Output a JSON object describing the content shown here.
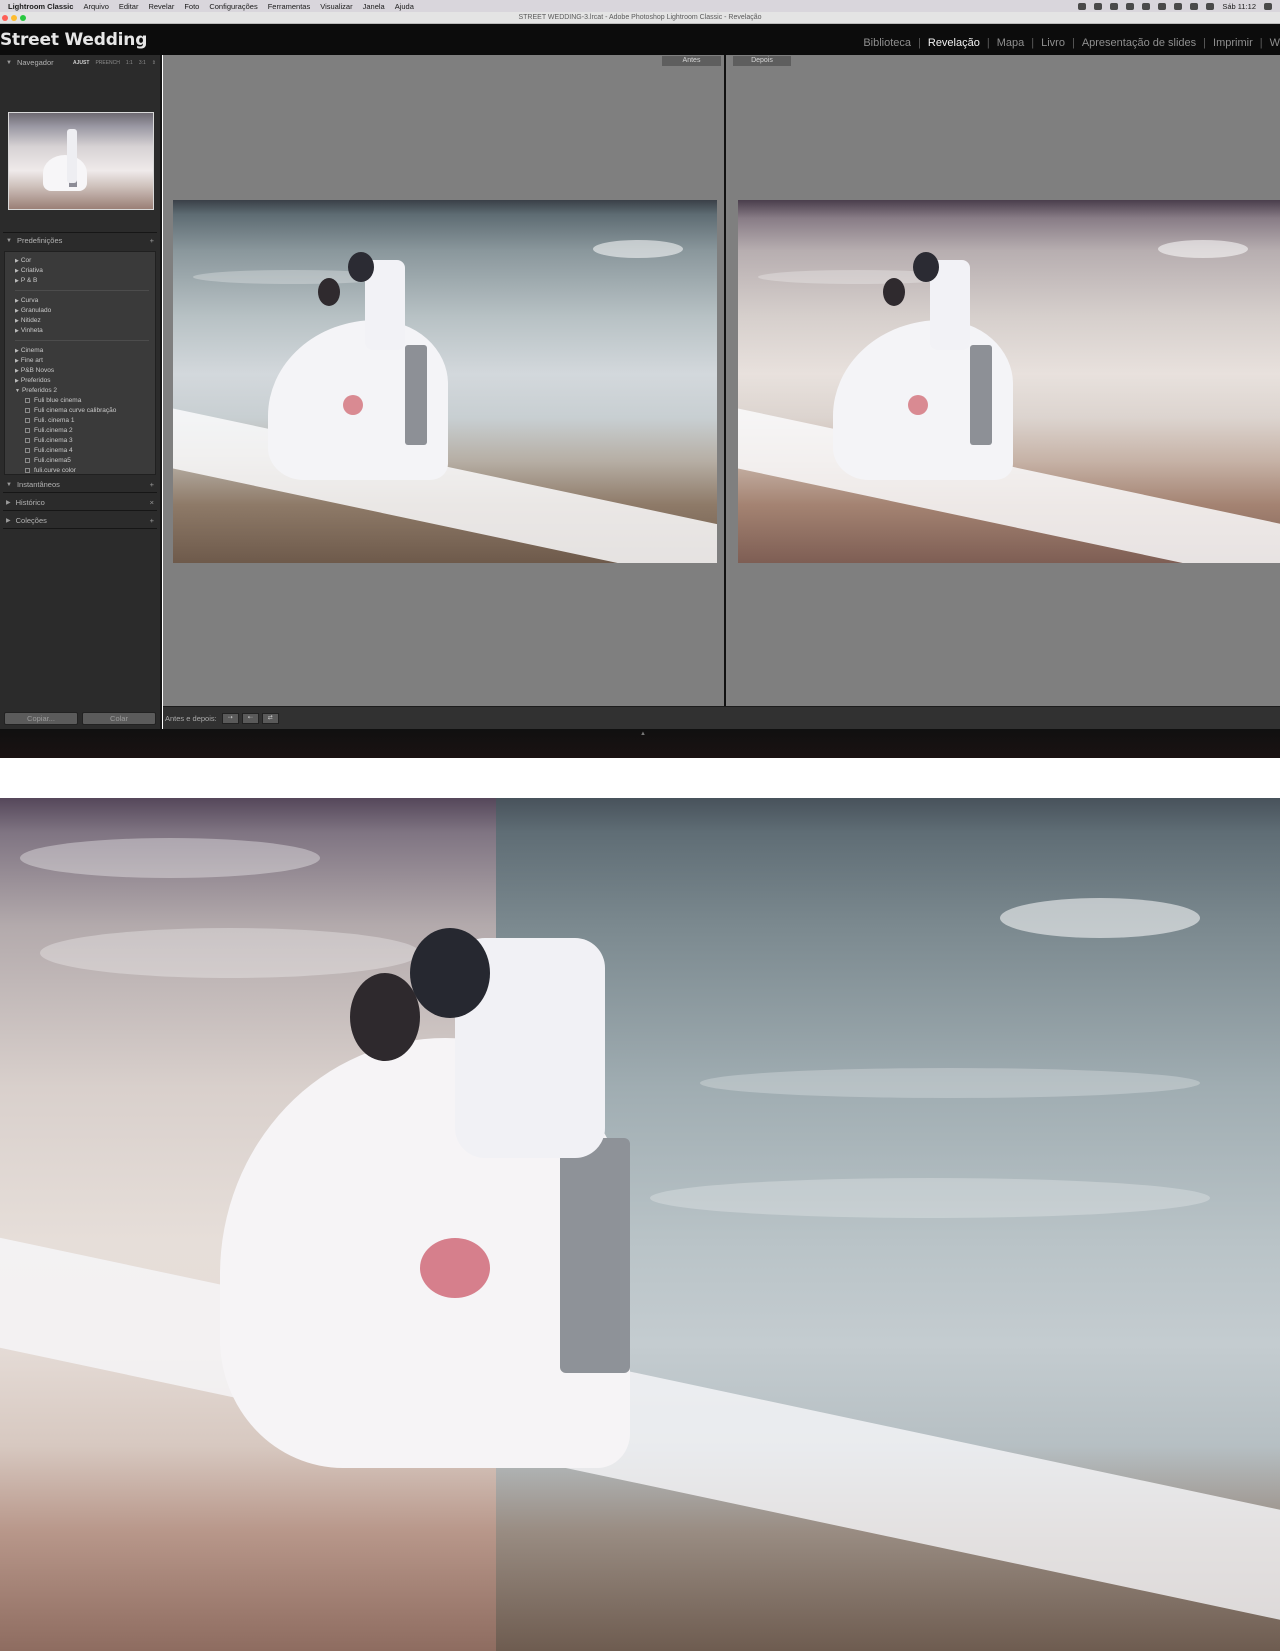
{
  "menubar": {
    "app_name": "Lightroom Classic",
    "items": [
      "Arquivo",
      "Editar",
      "Revelar",
      "Foto",
      "Configurações",
      "Ferramentas",
      "Visualizar",
      "Janela",
      "Ajuda"
    ],
    "clock": "Sáb 11:12"
  },
  "window": {
    "title": "STREET WEDDING-3.lrcat - Adobe Photoshop Lightroom Classic - Revelação"
  },
  "identity_plate": "Street Wedding",
  "modules": [
    {
      "label": "Biblioteca",
      "active": false
    },
    {
      "label": "Revelação",
      "active": true
    },
    {
      "label": "Mapa",
      "active": false
    },
    {
      "label": "Livro",
      "active": false
    },
    {
      "label": "Apresentação de slides",
      "active": false
    },
    {
      "label": "Imprimir",
      "active": false
    },
    {
      "label": "W",
      "active": false
    }
  ],
  "navigator": {
    "label": "Navegador",
    "zoom_options": [
      "AJUST",
      "PREENCH",
      "1:1",
      "3:1"
    ]
  },
  "presets": {
    "label": "Predefinições",
    "groups": [
      [
        "Cor",
        "Criativa",
        "P & B"
      ],
      [
        "Curva",
        "Granulado",
        "Nitidez",
        "Vinheta"
      ],
      [
        "Cinema",
        "Fine art",
        "P&B Novos",
        "Preferidos"
      ]
    ],
    "expanded_folder": "Preferidos 2",
    "expanded_items": [
      "Fuli blue cinema",
      "Fuli cinema curve calibração",
      "Fuli. cinema 1",
      "Fuli.cinema 2",
      "Fuli.cinema 3",
      "Fuli.cinema 4",
      "Fuli.cinema5",
      "fuli.curve color"
    ]
  },
  "panels": {
    "snapshots": "Instantâneos",
    "history": "Histórico",
    "collections": "Coleções"
  },
  "buttons": {
    "copy": "Copiar...",
    "paste": "Colar"
  },
  "compare": {
    "before_label": "Antes",
    "after_label": "Depois"
  },
  "toolbar": {
    "before_after_label": "Antes e depois:"
  }
}
